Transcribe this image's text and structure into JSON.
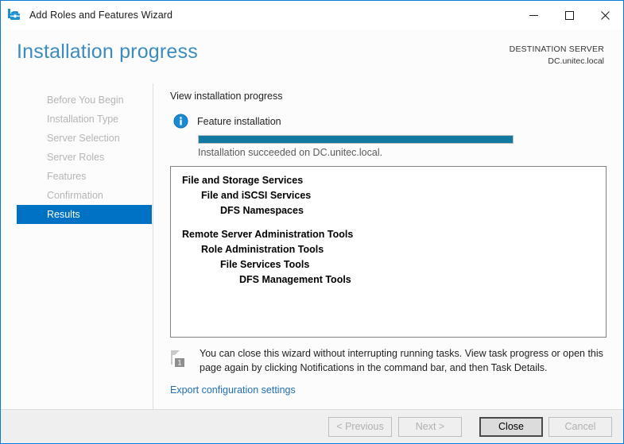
{
  "window": {
    "title": "Add Roles and Features Wizard",
    "icon": "wizard-toolbox-icon",
    "controls": {
      "minimize": "—",
      "maximize": "□",
      "close": "✕"
    },
    "accent_color": "#0a79d6"
  },
  "header": {
    "page_title": "Installation progress",
    "destination_label": "DESTINATION SERVER",
    "destination_name": "DC.unitec.local",
    "title_color": "#3b8bbd"
  },
  "sidebar": {
    "items": [
      {
        "label": "Before You Begin",
        "active": false
      },
      {
        "label": "Installation Type",
        "active": false
      },
      {
        "label": "Server Selection",
        "active": false
      },
      {
        "label": "Server Roles",
        "active": false
      },
      {
        "label": "Features",
        "active": false
      },
      {
        "label": "Confirmation",
        "active": false
      },
      {
        "label": "Results",
        "active": true
      }
    ],
    "active_color": "#0072c6",
    "inactive_color": "#b5b5b5"
  },
  "main": {
    "content_title": "View installation progress",
    "feature_icon": "info-icon",
    "feature_label": "Feature installation",
    "progress_percent": 100,
    "progress_color": "#1279a0",
    "progress_status": "Installation succeeded on DC.unitec.local.",
    "results": [
      {
        "text": "File and Storage Services",
        "level": 0,
        "spacer_after": false
      },
      {
        "text": "File and iSCSI Services",
        "level": 1,
        "spacer_after": false
      },
      {
        "text": "DFS Namespaces",
        "level": 2,
        "spacer_after": true
      },
      {
        "text": "Remote Server Administration Tools",
        "level": 0,
        "spacer_after": false
      },
      {
        "text": "Role Administration Tools",
        "level": 1,
        "spacer_after": false
      },
      {
        "text": "File Services Tools",
        "level": 2,
        "spacer_after": false
      },
      {
        "text": "DFS Management Tools",
        "level": 3,
        "spacer_after": false
      }
    ],
    "notice": {
      "icon": "notification-flag-icon",
      "badge_count": "1",
      "text": "You can close this wizard without interrupting running tasks. View task progress or open this page again by clicking Notifications in the command bar, and then Task Details."
    },
    "export_link": "Export configuration settings",
    "link_color": "#1f6fb3"
  },
  "footer": {
    "buttons": [
      {
        "id": "previous",
        "label": "< Previous",
        "enabled": false,
        "default": false
      },
      {
        "id": "next",
        "label": "Next >",
        "enabled": false,
        "default": false
      },
      {
        "id": "close",
        "label": "Close",
        "enabled": true,
        "default": true
      },
      {
        "id": "cancel",
        "label": "Cancel",
        "enabled": false,
        "default": false
      }
    ]
  }
}
